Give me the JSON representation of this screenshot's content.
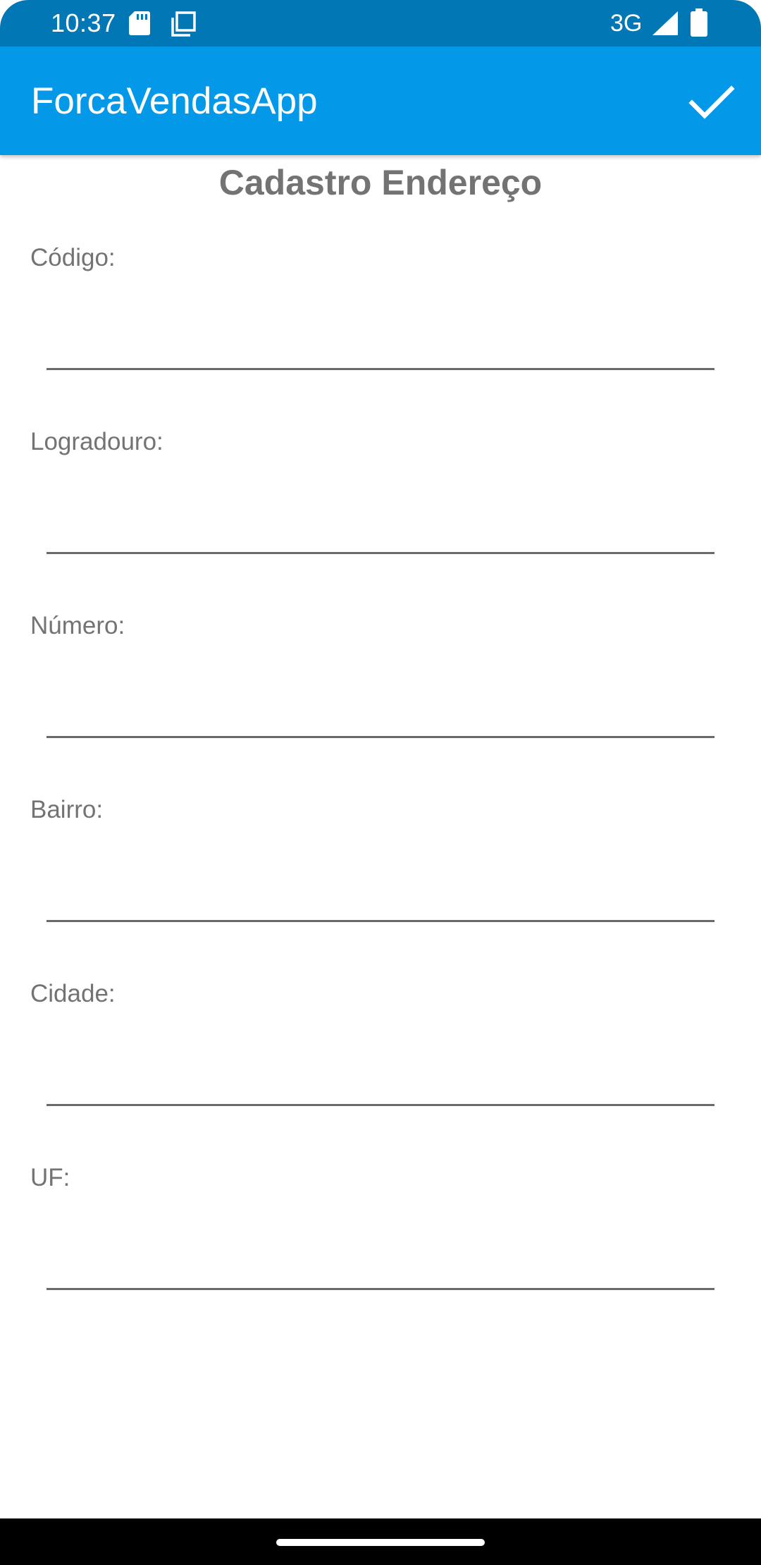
{
  "status_bar": {
    "time": "10:37",
    "network": "3G",
    "icons": [
      "sd-card-icon",
      "copy-icon",
      "cell-signal-icon",
      "battery-icon"
    ]
  },
  "app_bar": {
    "title": "ForcaVendasApp",
    "confirm_icon": "check-icon"
  },
  "form": {
    "title": "Cadastro Endereço",
    "fields": [
      {
        "label": "Código:",
        "value": "",
        "placeholder": ""
      },
      {
        "label": "Logradouro:",
        "value": "",
        "placeholder": ""
      },
      {
        "label": "Número:",
        "value": "",
        "placeholder": ""
      },
      {
        "label": "Bairro:",
        "value": "",
        "placeholder": ""
      },
      {
        "label": "Cidade:",
        "value": "",
        "placeholder": ""
      },
      {
        "label": "UF:",
        "value": "",
        "placeholder": ""
      }
    ]
  },
  "colors": {
    "status_bar": "#0277b6",
    "app_bar": "#0398e8",
    "label_text": "#737373",
    "underline": "#6a6a6a",
    "nav_bar": "#000000"
  }
}
